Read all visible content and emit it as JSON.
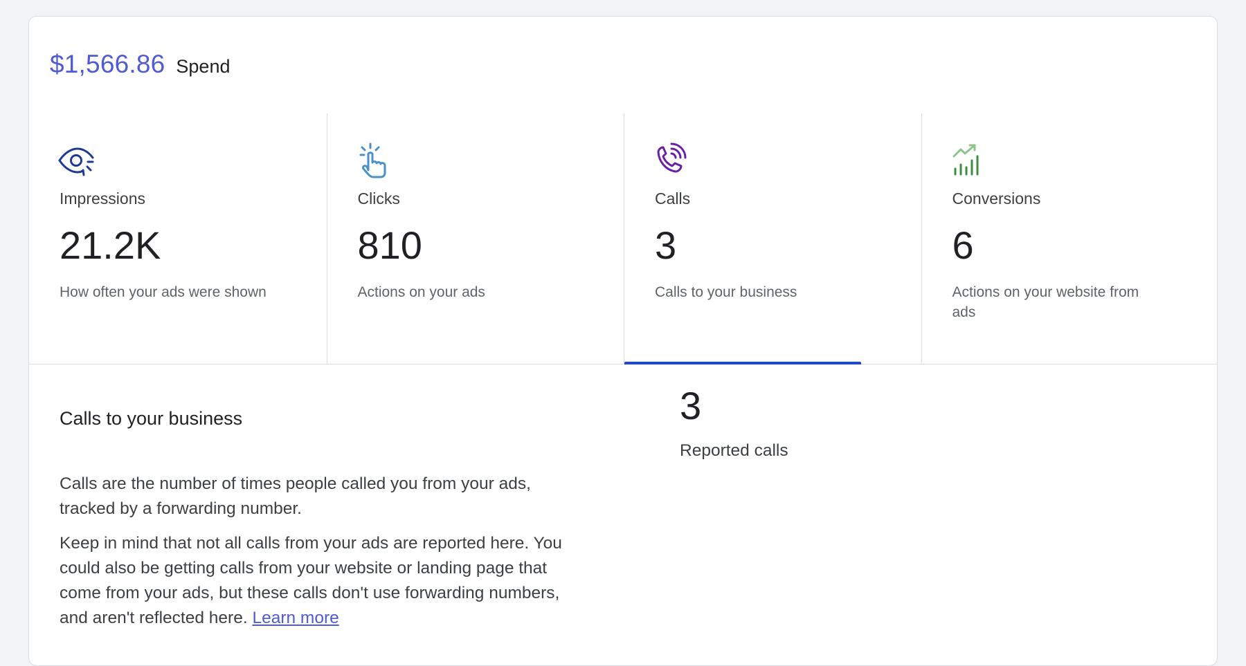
{
  "spend": {
    "amount": "$1,566.86",
    "label": "Spend"
  },
  "tiles": [
    {
      "icon": "eye-icon",
      "label": "Impressions",
      "value": "21.2K",
      "description": "How often your ads were shown",
      "selected": false
    },
    {
      "icon": "tap-icon",
      "label": "Clicks",
      "value": "810",
      "description": "Actions on your ads",
      "selected": false
    },
    {
      "icon": "phone-call-icon",
      "label": "Calls",
      "value": "3",
      "description": "Calls to your business",
      "selected": true
    },
    {
      "icon": "bar-chart-trend-icon",
      "label": "Conversions",
      "value": "6",
      "description": "Actions on your website from ads",
      "selected": false
    }
  ],
  "detail": {
    "title": "Calls to your business",
    "paragraph1": "Calls are the number of times people called you from your ads, tracked by a forwarding number.",
    "paragraph2": "Keep in mind that not all calls from your ads are reported here. You could also be getting calls from your website or landing page that come from your ads, but these calls don't use forwarding numbers, and aren't reflected here.",
    "learn_more": "Learn more",
    "reported_value": "3",
    "reported_label": "Reported calls"
  },
  "colors": {
    "accent": "#4f5bd5",
    "selected_underline": "#1a48d6",
    "impressions_icon": "#1f3a93",
    "clicks_icon": "#4a90c8",
    "calls_icon": "#6a1fa8",
    "conversions_icon": "#3d8b3d"
  }
}
